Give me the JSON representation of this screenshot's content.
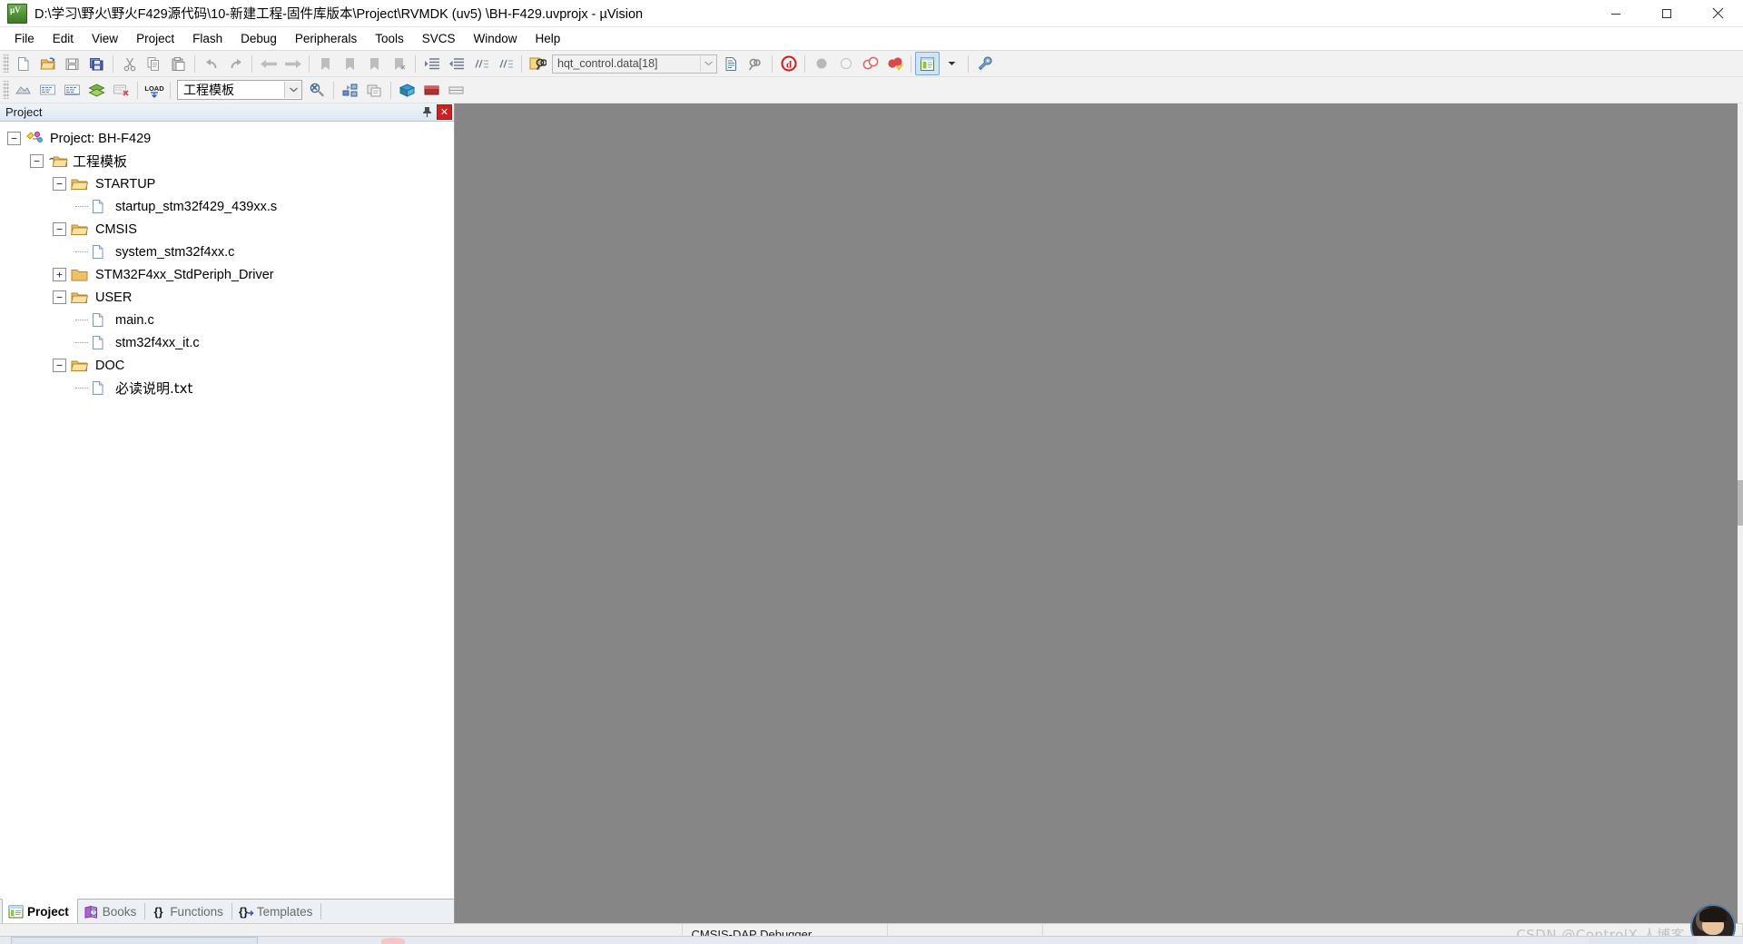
{
  "window": {
    "title": "D:\\学习\\野火\\野火F429源代码\\10-新建工程-固件库版本\\Project\\RVMDK (uv5) \\BH-F429.uvprojx - µVision",
    "app_icon": "uvision-icon",
    "minimize_label": "Minimize",
    "maximize_label": "Maximize",
    "close_label": "Close"
  },
  "menubar": {
    "items": [
      {
        "label": "File",
        "mnemonic": "F"
      },
      {
        "label": "Edit",
        "mnemonic": "E"
      },
      {
        "label": "View",
        "mnemonic": "V"
      },
      {
        "label": "Project",
        "mnemonic": "P"
      },
      {
        "label": "Flash",
        "mnemonic": "l"
      },
      {
        "label": "Debug",
        "mnemonic": "D"
      },
      {
        "label": "Peripherals",
        "mnemonic": "P"
      },
      {
        "label": "Tools",
        "mnemonic": "T"
      },
      {
        "label": "SVCS",
        "mnemonic": "S"
      },
      {
        "label": "Window",
        "mnemonic": "W"
      },
      {
        "label": "Help",
        "mnemonic": "H"
      }
    ]
  },
  "toolbar_main": {
    "buttons": [
      {
        "name": "new-file-icon",
        "tooltip": "New"
      },
      {
        "name": "open-file-icon",
        "tooltip": "Open"
      },
      {
        "name": "save-icon",
        "tooltip": "Save"
      },
      {
        "name": "save-all-icon",
        "tooltip": "Save All"
      },
      {
        "name": "cut-icon",
        "tooltip": "Cut"
      },
      {
        "name": "copy-icon",
        "tooltip": "Copy"
      },
      {
        "name": "paste-icon",
        "tooltip": "Paste"
      },
      {
        "name": "undo-icon",
        "tooltip": "Undo"
      },
      {
        "name": "redo-icon",
        "tooltip": "Redo"
      },
      {
        "name": "navigate-back-icon",
        "tooltip": "Back"
      },
      {
        "name": "navigate-forward-icon",
        "tooltip": "Forward"
      },
      {
        "name": "bookmark-toggle-icon",
        "tooltip": "Insert/Remove Bookmark"
      },
      {
        "name": "bookmark-prev-icon",
        "tooltip": "Previous Bookmark"
      },
      {
        "name": "bookmark-next-icon",
        "tooltip": "Next Bookmark"
      },
      {
        "name": "bookmark-clear-icon",
        "tooltip": "Clear All Bookmarks"
      },
      {
        "name": "indent-icon",
        "tooltip": "Indent"
      },
      {
        "name": "outdent-icon",
        "tooltip": "Outdent"
      },
      {
        "name": "comment-icon",
        "tooltip": "Comment"
      },
      {
        "name": "uncomment-icon",
        "tooltip": "Uncomment"
      },
      {
        "name": "find-in-files-icon",
        "tooltip": "Find in Files"
      }
    ],
    "search": {
      "value": "hqt_control.data[18]",
      "placeholder": ""
    },
    "after_search": [
      {
        "name": "incremental-find-icon",
        "tooltip": "Incremental Find"
      },
      {
        "name": "find-next-icon",
        "tooltip": "Find Next"
      },
      {
        "name": "debug-stop-icon",
        "tooltip": "Stop Build"
      }
    ],
    "breakpoints": [
      {
        "name": "insert-breakpoint-icon",
        "tooltip": "Insert/Remove Breakpoint"
      },
      {
        "name": "enable-breakpoint-icon",
        "tooltip": "Enable/Disable Breakpoint"
      },
      {
        "name": "disable-all-breakpoints-icon",
        "tooltip": "Disable All Breakpoints"
      },
      {
        "name": "kill-all-breakpoints-icon",
        "tooltip": "Kill All Breakpoints"
      }
    ],
    "window_buttons": [
      {
        "name": "project-window-icon",
        "tooltip": "Project Window",
        "active": true
      },
      {
        "name": "window-dropdown-icon",
        "tooltip": "More Windows"
      },
      {
        "name": "configuration-wizard-icon",
        "tooltip": "Configure"
      }
    ]
  },
  "toolbar_build": {
    "buttons": [
      {
        "name": "translate-icon",
        "tooltip": "Translate"
      },
      {
        "name": "build-icon",
        "tooltip": "Build"
      },
      {
        "name": "rebuild-icon",
        "tooltip": "Rebuild"
      },
      {
        "name": "batch-build-icon",
        "tooltip": "Batch Build"
      },
      {
        "name": "stop-build-icon",
        "tooltip": "Stop Build"
      },
      {
        "name": "download-icon",
        "tooltip": "Download",
        "label": "LOAD"
      },
      {
        "name": "target-options-icon",
        "tooltip": "Options for Target"
      }
    ],
    "target_select": {
      "value": "工程模板",
      "options": [
        "工程模板"
      ]
    },
    "after_target": [
      {
        "name": "target-options-wrench-icon",
        "tooltip": "Options for Target"
      },
      {
        "name": "manage-project-items-icon",
        "tooltip": "Manage Project Items"
      },
      {
        "name": "manage-multi-project-icon",
        "tooltip": "Multi-Project"
      },
      {
        "name": "pack-installer-icon",
        "tooltip": "Pack Installer"
      },
      {
        "name": "manage-run-time-env-icon",
        "tooltip": "Manage Run-Time Environment"
      },
      {
        "name": "select-software-packs-icon",
        "tooltip": "Select Software Packs"
      }
    ]
  },
  "project_panel": {
    "header_title": "Project",
    "pin_label": "Auto Hide",
    "close_label": "Close",
    "tree": [
      {
        "label": "Project: BH-F429",
        "level": 0,
        "icon": "project-icon",
        "expander": "minus",
        "cjk": false
      },
      {
        "label": "工程模板",
        "level": 1,
        "icon": "target-icon",
        "expander": "minus",
        "cjk": true
      },
      {
        "label": "STARTUP",
        "level": 2,
        "icon": "folder-open-icon",
        "expander": "minus",
        "cjk": false
      },
      {
        "label": "startup_stm32f429_439xx.s",
        "level": 3,
        "icon": "file-icon",
        "expander": "none",
        "cjk": false
      },
      {
        "label": "CMSIS",
        "level": 2,
        "icon": "folder-open-icon",
        "expander": "minus",
        "cjk": false
      },
      {
        "label": "system_stm32f4xx.c",
        "level": 3,
        "icon": "file-icon",
        "expander": "none",
        "cjk": false
      },
      {
        "label": "STM32F4xx_StdPeriph_Driver",
        "level": 2,
        "icon": "folder-closed-icon",
        "expander": "plus",
        "cjk": false
      },
      {
        "label": "USER",
        "level": 2,
        "icon": "folder-open-icon",
        "expander": "minus",
        "cjk": false
      },
      {
        "label": "main.c",
        "level": 3,
        "icon": "file-icon",
        "expander": "none",
        "cjk": false
      },
      {
        "label": "stm32f4xx_it.c",
        "level": 3,
        "icon": "file-icon",
        "expander": "none",
        "cjk": false
      },
      {
        "label": "DOC",
        "level": 2,
        "icon": "folder-open-icon",
        "expander": "minus",
        "cjk": false
      },
      {
        "label": "必读说明.txt",
        "level": 3,
        "icon": "file-icon",
        "expander": "none",
        "cjk": true
      }
    ]
  },
  "bottom_tabs": [
    {
      "label": "Project",
      "icon": "project-tab-icon",
      "selected": true
    },
    {
      "label": "Books",
      "icon": "books-tab-icon",
      "selected": false
    },
    {
      "label": "Functions",
      "icon": "functions-tab-icon",
      "selected": false
    },
    {
      "label": "Templates",
      "icon": "templates-tab-icon",
      "selected": false
    }
  ],
  "statusbar": {
    "left": "",
    "debugger": "CMSIS-DAP Debugger",
    "cell2": "",
    "cell3": "",
    "watermark": "CSDN @ControlX 人博客"
  },
  "colors": {
    "accent": "#cfe4f7",
    "panel_header_from": "#eef3f9",
    "panel_header_to": "#dde7f2",
    "editor_bg": "#868686",
    "close_red": "#cf2020",
    "folder": "#e8b85d",
    "chrome": "#f0f0f0"
  }
}
